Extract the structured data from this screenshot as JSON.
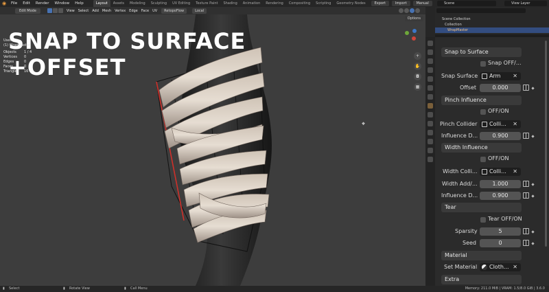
{
  "topbar": {
    "menus": [
      "File",
      "Edit",
      "Render",
      "Window",
      "Help"
    ],
    "workspaces": [
      "Layout",
      "Assets",
      "Modeling",
      "Sculpting",
      "UV Editing",
      "Texture Paint",
      "Shading",
      "Animation",
      "Rendering",
      "Compositing",
      "Scripting",
      "Geometry Nodes"
    ],
    "buttons": [
      "Export",
      "Import",
      "Manual"
    ],
    "scene": "Scene",
    "view_layer": "View Layer"
  },
  "viewport_header": {
    "mode": "Edit Mode",
    "menus": [
      "View",
      "Select",
      "Add",
      "Mesh",
      "Vertex",
      "Edge",
      "Face",
      "UV"
    ],
    "addon": "RetopoFlow",
    "transform": "Local",
    "options": "Options"
  },
  "overlay": {
    "line1": "SNAP TO SURFACE",
    "line2": "+OFFSET"
  },
  "stats": {
    "mode_label": "User",
    "object_line": "(1) WrapMaster",
    "rows": [
      {
        "key": "Objects",
        "value": "1 / 4"
      },
      {
        "key": "Vertices",
        "value": "0"
      },
      {
        "key": "Edges",
        "value": "0"
      },
      {
        "key": "Faces",
        "value": "0"
      },
      {
        "key": "Triangles",
        "value": "16"
      }
    ]
  },
  "outliner": {
    "rows": [
      "Scene Collection",
      "Collection",
      "WrapMaster"
    ]
  },
  "properties": {
    "snap_header": "Snap to Surface",
    "snap_toggle": "Snap OFF/...",
    "snap_surface_label": "Snap Surface",
    "snap_surface_value": "Arm",
    "offset_label": "Offset",
    "offset_value": "0.000",
    "pinch_header": "Pinch Influence",
    "pinch_toggle": "OFF/ON",
    "pinch_collider_label": "Pinch Collider",
    "pinch_collider_value": "Colli...",
    "pinch_influence_label": "Influence D...",
    "pinch_influence_value": "0.900",
    "width_header": "Width Influence",
    "width_toggle": "OFF/ON",
    "width_collider_label": "Width Colli...",
    "width_collider_value": "Colli...",
    "width_add_label": "Width Add/...",
    "width_add_value": "1.000",
    "width_influence_label": "Influence D...",
    "width_influence_value": "0.900",
    "tear_header": "Tear",
    "tear_toggle": "Tear OFF/ON",
    "sparsity_label": "Sparsity",
    "sparsity_value": "5",
    "seed_label": "Seed",
    "seed_value": "0",
    "material_header": "Material",
    "set_material_label": "Set Material",
    "set_material_value": "Cloth...",
    "extra_header": "Extra"
  },
  "statusbar": {
    "select": "Select",
    "rotate": "Rotate View",
    "call_menu": "Call Menu",
    "memory": "Memory: 211.0 MiB | VRAM: 1.5/8.0 GiB | 3.6.0"
  }
}
